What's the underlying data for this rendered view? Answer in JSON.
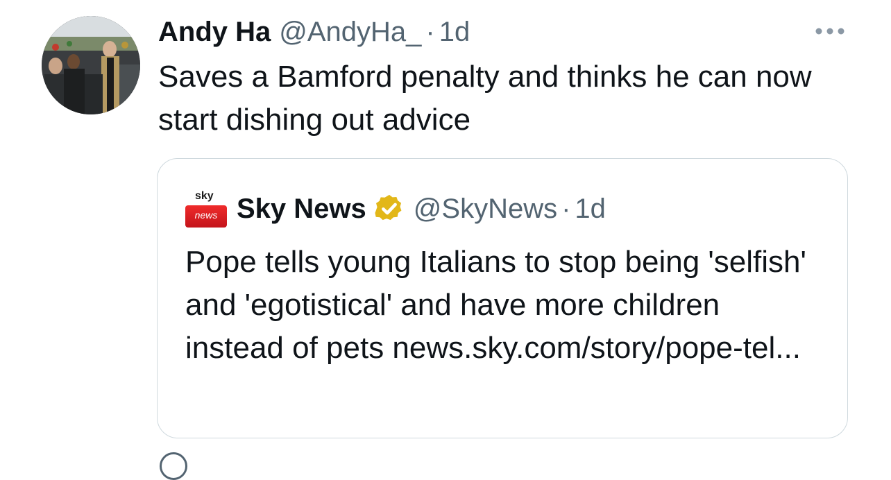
{
  "tweet": {
    "author": {
      "display_name": "Andy Ha",
      "handle": "@AndyHa_",
      "separator": "·",
      "time": "1d",
      "avatar_icon": "profile-photo"
    },
    "more_icon": "more-dots-icon",
    "text": "Saves a Bamford penalty and thinks he can now start dishing out advice"
  },
  "quoted_tweet": {
    "logo_text_top": "sky",
    "logo_text_bottom": "news",
    "display_name": "Sky News",
    "verified_icon": "verified-badge-icon",
    "verified_color": "#e2b719",
    "handle": "@SkyNews",
    "separator": "·",
    "time": "1d",
    "text": "Pope tells young Italians to stop being 'selfish' and 'egotistical' and have more children instead of pets news.sky.com/story/pope-tel..."
  },
  "colors": {
    "text_primary": "#0f1419",
    "text_secondary": "#536471",
    "border": "#cfd9de",
    "sky_red": "#d91e25"
  }
}
